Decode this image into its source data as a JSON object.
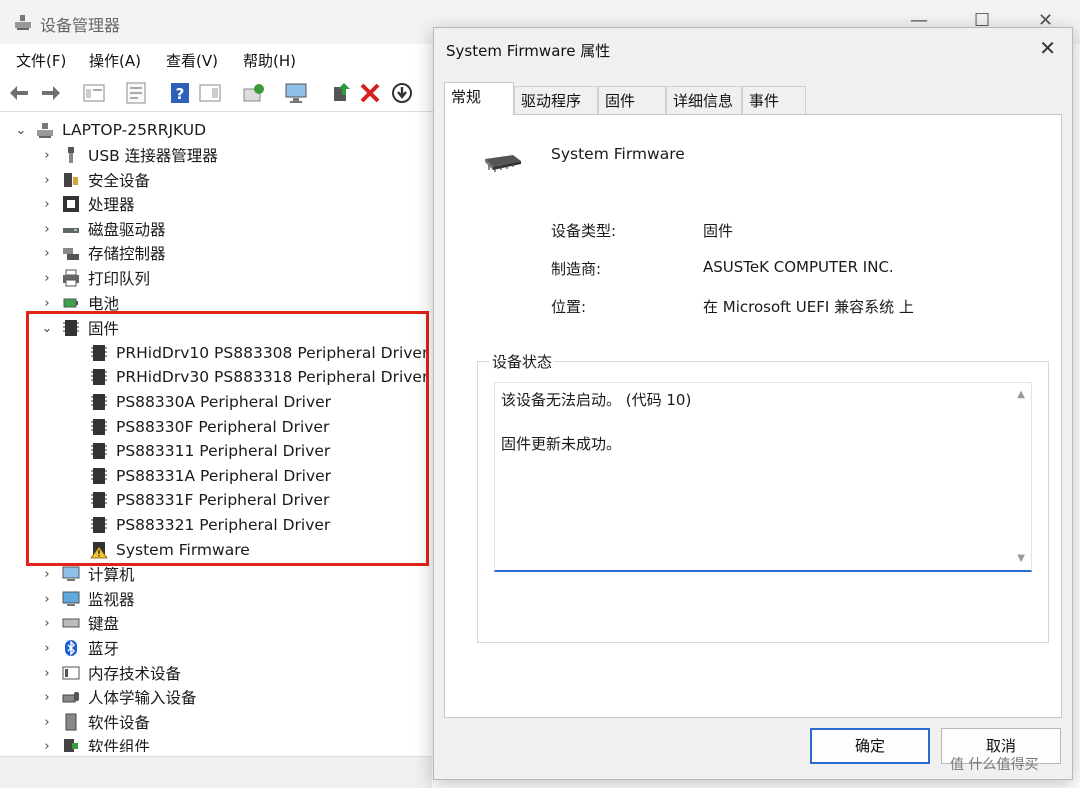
{
  "device_manager": {
    "title": "设备管理器",
    "window_controls": {
      "minimize": "—",
      "maximize": "☐",
      "close": "✕"
    },
    "menu": [
      "文件(F)",
      "操作(A)",
      "查看(V)",
      "帮助(H)"
    ],
    "tree": {
      "root": "LAPTOP-25RRJKUD",
      "categories_before": [
        {
          "label": "USB 连接器管理器",
          "icon": "usb-icon"
        },
        {
          "label": "安全设备",
          "icon": "security-device-icon"
        },
        {
          "label": "处理器",
          "icon": "processor-icon"
        },
        {
          "label": "磁盘驱动器",
          "icon": "disk-drive-icon"
        },
        {
          "label": "存储控制器",
          "icon": "storage-controller-icon"
        },
        {
          "label": "打印队列",
          "icon": "printer-icon"
        },
        {
          "label": "电池",
          "icon": "battery-icon"
        }
      ],
      "firmware": {
        "label": "固件",
        "children": [
          "PRHidDrv10 PS883308 Peripheral Driver",
          "PRHidDrv30 PS883318 Peripheral Driver",
          "PS88330A Peripheral Driver",
          "PS88330F Peripheral Driver",
          "PS883311 Peripheral Driver",
          "PS88331A Peripheral Driver",
          "PS88331F Peripheral Driver",
          "PS883321 Peripheral Driver",
          "System Firmware"
        ]
      },
      "categories_after": [
        {
          "label": "计算机",
          "icon": "computer-icon"
        },
        {
          "label": "监视器",
          "icon": "monitor-icon"
        },
        {
          "label": "键盘",
          "icon": "keyboard-icon"
        },
        {
          "label": "蓝牙",
          "icon": "bluetooth-icon"
        },
        {
          "label": "内存技术设备",
          "icon": "memory-device-icon"
        },
        {
          "label": "人体学输入设备",
          "icon": "hid-icon"
        },
        {
          "label": "软件设备",
          "icon": "software-device-icon"
        },
        {
          "label": "软件组件",
          "icon": "software-component-icon"
        }
      ]
    }
  },
  "dialog": {
    "title": "System Firmware 属性",
    "close": "✕",
    "tabs": [
      "常规",
      "驱动程序",
      "固件",
      "详细信息",
      "事件"
    ],
    "device_name": "System Firmware",
    "properties": [
      {
        "label": "设备类型:",
        "value": "固件"
      },
      {
        "label": "制造商:",
        "value": "ASUSTeK COMPUTER INC."
      },
      {
        "label": "位置:",
        "value": "在 Microsoft UEFI 兼容系统 上"
      }
    ],
    "status_legend": "设备状态",
    "status_lines": [
      "该设备无法启动。 (代码 10)",
      "固件更新未成功。"
    ],
    "ok_label": "确定",
    "cancel_label": "取消"
  },
  "watermark": "值 什么值得买",
  "colors": {
    "highlight": "#e2231a",
    "accent": "#2b6cd4"
  }
}
